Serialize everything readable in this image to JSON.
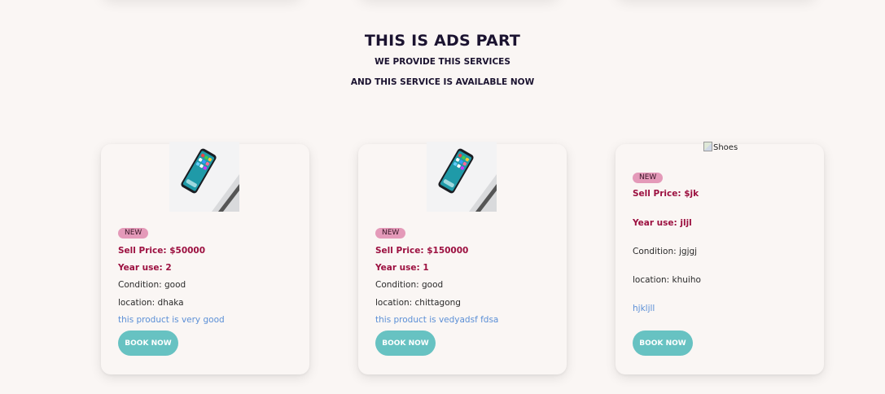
{
  "header": {
    "title": "THIS IS ADS PART",
    "subtitle_1": "WE PROVIDE THIS SERVICES",
    "subtitle_2": "AND THIS SERVICE IS AVAILABLE NOW"
  },
  "cards": [
    {
      "badge": "NEW",
      "price": "Sell Price: $50000",
      "year": "Year use: 2",
      "condition": "Condition: good",
      "location": "location: dhaka",
      "description": "this product is very good",
      "button": "BOOK NOW"
    },
    {
      "badge": "NEW",
      "price": "Sell Price: $150000",
      "year": "Year use: 1",
      "condition": "Condition: good",
      "location": "location: chittagong",
      "description": "this product is vedyadsf fdsa",
      "button": "BOOK NOW"
    },
    {
      "image_alt": "Shoes",
      "badge": "NEW",
      "price": "Sell Price: $jk",
      "year": "Year use: jljl",
      "condition": "Condition: jgjgj",
      "location": "location: khuiho",
      "description": "hjkljll",
      "button": "BOOK NOW"
    }
  ],
  "colors": {
    "background": "#faf6f4",
    "heading": "#1b1330",
    "price": "#9c1040",
    "badge": "#e49ab9",
    "link_text": "#5b8fd6",
    "button": "#67c2c2"
  }
}
